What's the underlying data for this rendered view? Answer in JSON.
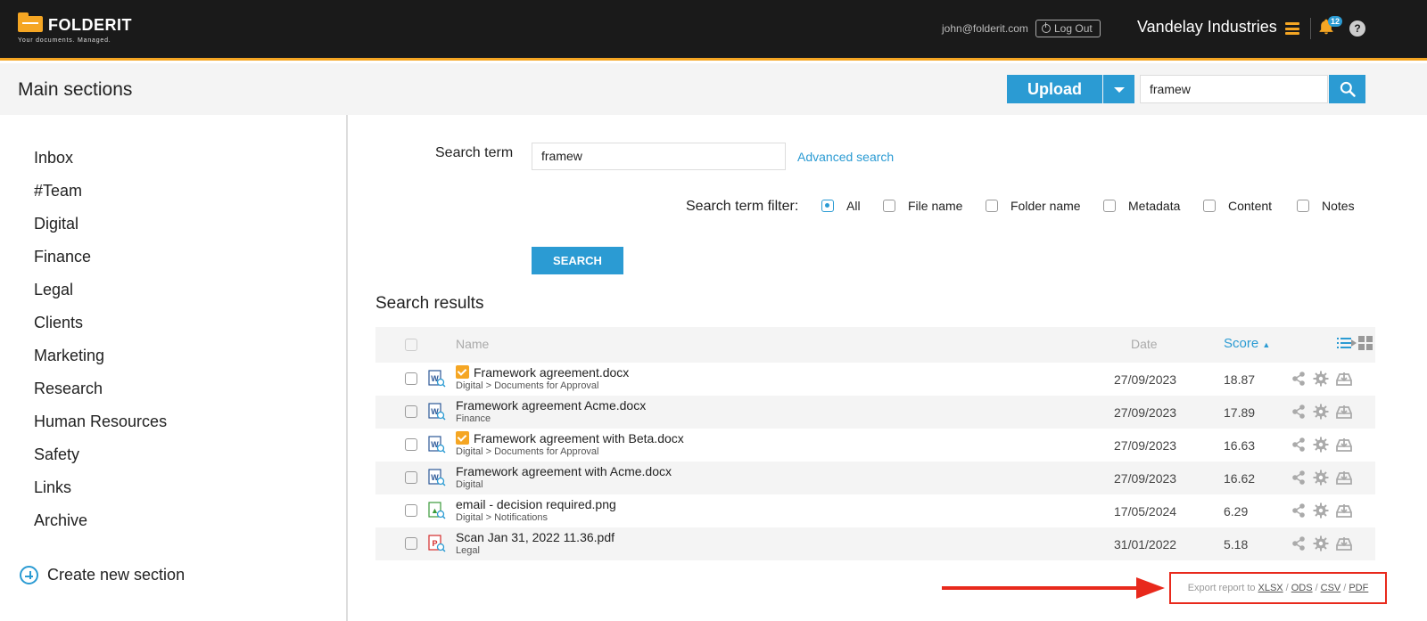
{
  "header": {
    "logo_text": "FOLDERIT",
    "tagline": "Your documents. Managed.",
    "user_email": "john@folderit.com",
    "logout_label": "Log Out",
    "company": "Vandelay Industries",
    "notification_count": "12",
    "help_label": "?"
  },
  "subheader": {
    "title": "Main sections",
    "upload_label": "Upload",
    "search_value": "framew"
  },
  "sidebar": {
    "items": [
      "Inbox",
      "#Team",
      "Digital",
      "Finance",
      "Legal",
      "Clients",
      "Marketing",
      "Research",
      "Human Resources",
      "Safety",
      "Links",
      "Archive"
    ],
    "create_label": "Create new section"
  },
  "search": {
    "term_label": "Search term",
    "term_value": "framew",
    "advanced_link": "Advanced search",
    "filter_label": "Search term filter:",
    "filters": [
      {
        "label": "All",
        "checked": true
      },
      {
        "label": "File name",
        "checked": false
      },
      {
        "label": "Folder name",
        "checked": false
      },
      {
        "label": "Metadata",
        "checked": false
      },
      {
        "label": "Content",
        "checked": false
      },
      {
        "label": "Notes",
        "checked": false
      }
    ],
    "button_label": "SEARCH"
  },
  "results": {
    "title": "Search results",
    "columns": {
      "name": "Name",
      "date": "Date",
      "score": "Score"
    },
    "rows": [
      {
        "name": "Framework agreement.docx",
        "path": "Digital > Documents for Approval",
        "date": "27/09/2023",
        "score": "18.87",
        "type": "word",
        "approved": true
      },
      {
        "name": "Framework agreement Acme.docx",
        "path": "Finance",
        "date": "27/09/2023",
        "score": "17.89",
        "type": "word",
        "approved": false
      },
      {
        "name": "Framework agreement with Beta.docx",
        "path": "Digital > Documents for Approval",
        "date": "27/09/2023",
        "score": "16.63",
        "type": "word",
        "approved": true
      },
      {
        "name": "Framework agreement with Acme.docx",
        "path": "Digital",
        "date": "27/09/2023",
        "score": "16.62",
        "type": "word",
        "approved": false
      },
      {
        "name": "email - decision required.png",
        "path": "Digital > Notifications",
        "date": "17/05/2024",
        "score": "6.29",
        "type": "image",
        "approved": false
      },
      {
        "name": "Scan Jan 31, 2022 11.36.pdf",
        "path": "Legal",
        "date": "31/01/2022",
        "score": "5.18",
        "type": "pdf",
        "approved": false
      }
    ]
  },
  "export": {
    "prefix": "Export report to",
    "formats": [
      "XLSX",
      "ODS",
      "CSV",
      "PDF"
    ]
  },
  "colors": {
    "accent": "#2b9bd3",
    "brand": "#f5a623",
    "highlight": "#e8291c"
  }
}
